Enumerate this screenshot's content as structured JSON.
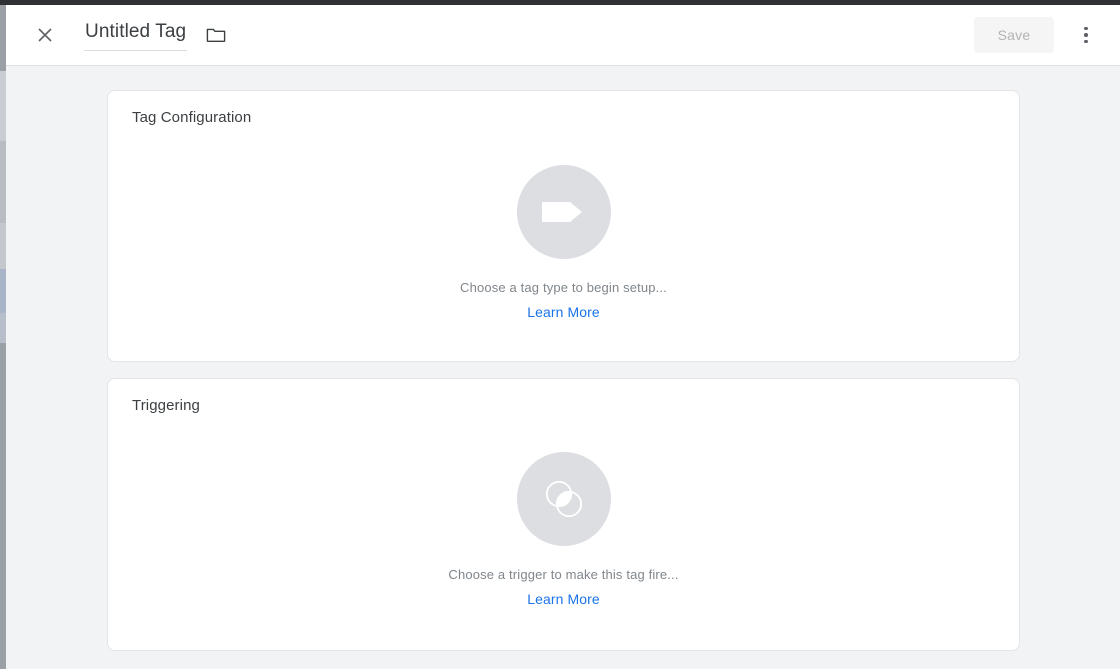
{
  "window": {
    "chrome_bar_color": "#303134",
    "page_background": "#f1f3f4"
  },
  "header": {
    "close_icon": "close-icon",
    "title_value": "Untitled Tag",
    "title_placeholder": "Untitled Tag",
    "folder_icon": "folder-icon",
    "save_label": "Save",
    "save_enabled": false,
    "more_options_icon": "kebab-menu-icon"
  },
  "cards": [
    {
      "id": "tag-configuration",
      "title": "Tag Configuration",
      "icon": "tag-icon",
      "empty_text": "Choose a tag type to begin setup...",
      "learn_more_label": "Learn More"
    },
    {
      "id": "triggering",
      "title": "Triggering",
      "icon": "trigger-icon",
      "empty_text": "Choose a trigger to make this tag fire...",
      "learn_more_label": "Learn More"
    }
  ],
  "colors": {
    "link": "#1a73e8",
    "empty_icon_bg": "#dcdee1",
    "muted_text": "#80868b",
    "title_text": "#3c4043",
    "save_disabled_bg": "#f5f5f5",
    "save_disabled_text": "#b4b4b4"
  }
}
